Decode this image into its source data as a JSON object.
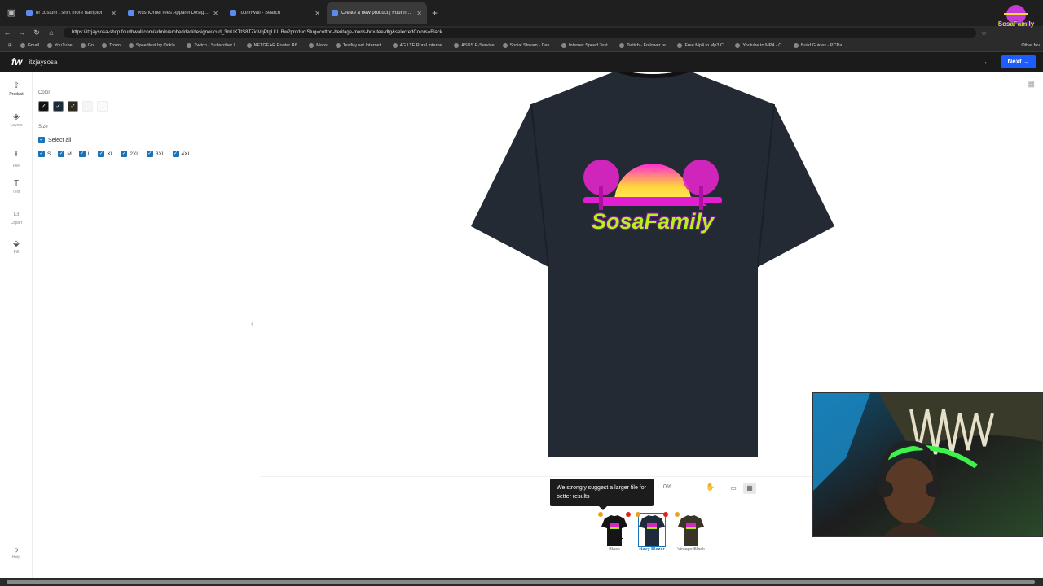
{
  "browser": {
    "tabs": [
      {
        "title": "ur custom t shirt more hampton",
        "active": false
      },
      {
        "title": "RushOrderTees Apparel Design S",
        "active": false
      },
      {
        "title": "fourthwall - Search",
        "active": false
      },
      {
        "title": "Create a new product | Fourthwall",
        "active": true
      }
    ],
    "url": "https://itzjaysosa-shop.fourthwall.com/admin/embedded/designer/cud_3mUKTtS8TZioVqPtgUULBw?productSlug=cotton-heritage-mens-box-tee-dtg&selectedColors=Black",
    "bookmarks": [
      "Gmail",
      "YouTube",
      "Go",
      "Trovo",
      "Speedtest by Ookla...",
      "Twitch - Subscriber l...",
      "NETGEAR Router R6...",
      "Maps",
      "TestMy.net Internet...",
      "4G LTE Rural Interne...",
      "ASUS E-Service",
      "Social Stream - Das...",
      "Internet Speed Test...",
      "Twitch - Follower re...",
      "Free Mp4 to Mp3 C...",
      "Youtube to MP4 - C...",
      "Build Guides - PCPa..."
    ],
    "bookmarks_other": "Other fav"
  },
  "app": {
    "logo": "fw",
    "shop_name": "itzjaysosa",
    "next_label": "Next →"
  },
  "rail": [
    {
      "label": "Product",
      "icon": "shirt-icon",
      "glyph": "⇧"
    },
    {
      "label": "Layers",
      "icon": "layers-icon",
      "glyph": "◈"
    },
    {
      "label": "File",
      "icon": "upload-icon",
      "glyph": "⭱"
    },
    {
      "label": "Text",
      "icon": "text-icon",
      "glyph": "T"
    },
    {
      "label": "Clipart",
      "icon": "smiley-icon",
      "glyph": "☺"
    },
    {
      "label": "Fill",
      "icon": "fill-icon",
      "glyph": "⬙"
    }
  ],
  "help_label": "Help",
  "panel": {
    "color_label": "Color",
    "swatches": [
      {
        "color": "#111111",
        "checked": true
      },
      {
        "color": "#1c2a38",
        "checked": true
      },
      {
        "color": "#2e2a20",
        "checked": true
      },
      {
        "color": "#f5f5f5",
        "checked": false
      },
      {
        "color": "#fafafa",
        "checked": false
      }
    ],
    "size_label": "Size",
    "select_all": "Select all",
    "sizes": [
      "S",
      "M",
      "L",
      "XL",
      "2XL",
      "3XL",
      "4XL"
    ]
  },
  "canvas": {
    "design_text": "SosaFamily",
    "shirt_color": "#232a33",
    "tooltip": "We strongly suggest a larger file for better results",
    "zoom": "0%",
    "variants": [
      {
        "label": "Black",
        "color": "#151515",
        "selected": false
      },
      {
        "label": "Navy Blazer",
        "color": "#1f2b3a",
        "selected": true
      },
      {
        "label": "Vintage Black",
        "color": "#3a3426",
        "selected": false
      }
    ]
  },
  "overlay": {
    "stream_logo": "SosaFamily"
  }
}
